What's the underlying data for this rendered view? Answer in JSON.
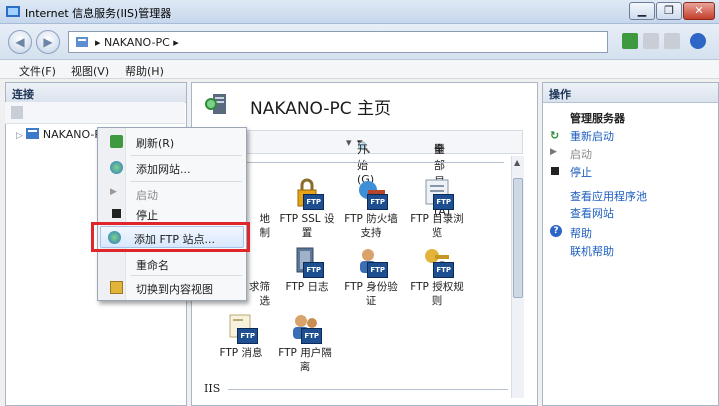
{
  "window": {
    "title": "Internet 信息服务(IIS)管理器"
  },
  "address": {
    "path": "NAKANO-PC"
  },
  "menu": [
    "文件(F)",
    "视图(V)",
    "帮助(H)"
  ],
  "left_pane": {
    "title": "连接",
    "tree_node": "NAKANO-PC"
  },
  "context_menu": {
    "items": [
      {
        "label": "刷新(R)",
        "icon": "refresh-icon",
        "disabled": false
      },
      {
        "label": "添加网站...",
        "icon": "add-website-icon",
        "disabled": false
      },
      {
        "label": "启动",
        "icon": "play-icon",
        "disabled": true
      },
      {
        "label": "停止",
        "icon": "stop-icon",
        "disabled": false
      },
      {
        "label": "添加 FTP 站点...",
        "icon": "add-ftp-site-icon",
        "disabled": false,
        "highlighted": true
      },
      {
        "label": "重命名",
        "icon": "",
        "disabled": false
      },
      {
        "label": "切换到内容视图",
        "icon": "content-view-icon",
        "disabled": false
      }
    ],
    "highlight_color": "#e0262b"
  },
  "center": {
    "title": "NAKANO-PC 主页",
    "toolbar": {
      "start_label": "开始(G)",
      "show_all_label": "全部显示(A)"
    },
    "features": [
      {
        "label": "地\n制",
        "icon": "ftp-ip-restrict-icon"
      },
      {
        "label": "FTP SSL 设\n置",
        "icon": "ftp-ssl-icon"
      },
      {
        "label": "FTP 防火墙\n支持",
        "icon": "ftp-firewall-icon"
      },
      {
        "label": "FTP 目录浏\n览",
        "icon": "ftp-directory-icon"
      },
      {
        "label": "求筛\n选",
        "icon": "ftp-request-filter-icon"
      },
      {
        "label": "FTP 日志",
        "icon": "ftp-log-icon"
      },
      {
        "label": "FTP 身份验\n证",
        "icon": "ftp-auth-icon"
      },
      {
        "label": "FTP 授权规\n则",
        "icon": "ftp-authz-icon"
      },
      {
        "label": "FTP 消息",
        "icon": "ftp-message-icon"
      },
      {
        "label": "FTP 用户隔\n离",
        "icon": "ftp-user-isolation-icon"
      }
    ],
    "section_iis": "IIS"
  },
  "right_pane": {
    "title": "操作",
    "group": "管理服务器",
    "actions": [
      {
        "label": "重新启动",
        "icon": "restart-icon",
        "disabled": false
      },
      {
        "label": "启动",
        "icon": "play-icon",
        "disabled": true
      },
      {
        "label": "停止",
        "icon": "stop-icon",
        "disabled": false
      },
      {
        "label": "查看应用程序池",
        "icon": "",
        "disabled": false
      },
      {
        "label": "查看网站",
        "icon": "",
        "disabled": false
      },
      {
        "label": "帮助",
        "icon": "help-icon",
        "disabled": false
      },
      {
        "label": "联机帮助",
        "icon": "",
        "disabled": false
      }
    ]
  },
  "colors": {
    "link": "#1c5dbf",
    "ftp_badge": "#1d4f91"
  }
}
